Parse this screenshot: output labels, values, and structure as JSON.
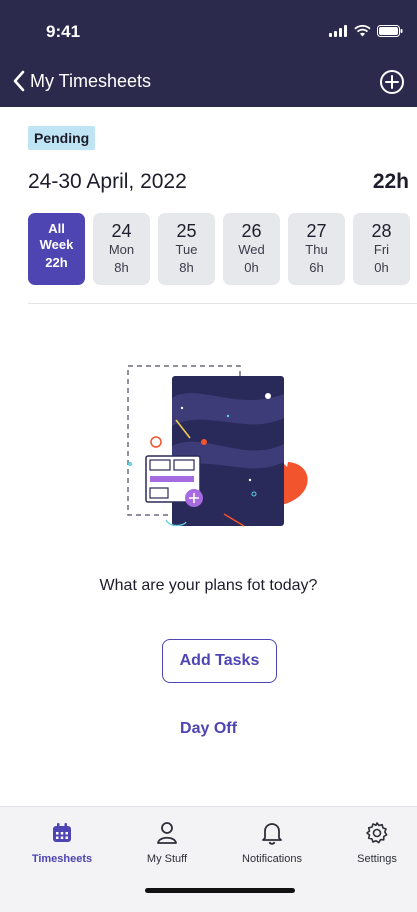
{
  "status_bar": {
    "time": "9:41"
  },
  "nav": {
    "back_label": "My Timesheets",
    "back_icon": "chevron-left-icon",
    "add_icon": "plus-circle-icon"
  },
  "timesheet": {
    "status_badge": "Pending",
    "week_range": "24-30 April, 2022",
    "week_total": "22h"
  },
  "days": {
    "all_week": {
      "line1": "All",
      "line2": "Week",
      "hours": "22h"
    },
    "items": [
      {
        "num": "24",
        "name": "Mon",
        "hours": "8h"
      },
      {
        "num": "25",
        "name": "Tue",
        "hours": "8h"
      },
      {
        "num": "26",
        "name": "Wed",
        "hours": "0h"
      },
      {
        "num": "27",
        "name": "Thu",
        "hours": "6h"
      },
      {
        "num": "28",
        "name": "Fri",
        "hours": "0h"
      }
    ]
  },
  "empty_state": {
    "prompt": "What are your plans fot today?",
    "add_tasks_label": "Add Tasks",
    "day_off_label": "Day Off"
  },
  "tabs": [
    {
      "label": "Timesheets",
      "icon": "calendar-icon",
      "active": true
    },
    {
      "label": "My Stuff",
      "icon": "person-icon",
      "active": false
    },
    {
      "label": "Notifications",
      "icon": "bell-icon",
      "active": false
    },
    {
      "label": "Settings",
      "icon": "gear-icon",
      "active": false
    }
  ],
  "colors": {
    "header_bg": "#2b2a4c",
    "accent": "#4e45b3",
    "badge_bg": "#bfe4f4",
    "day_bg": "#e6e8ec",
    "illustration_orange": "#f2542d"
  }
}
